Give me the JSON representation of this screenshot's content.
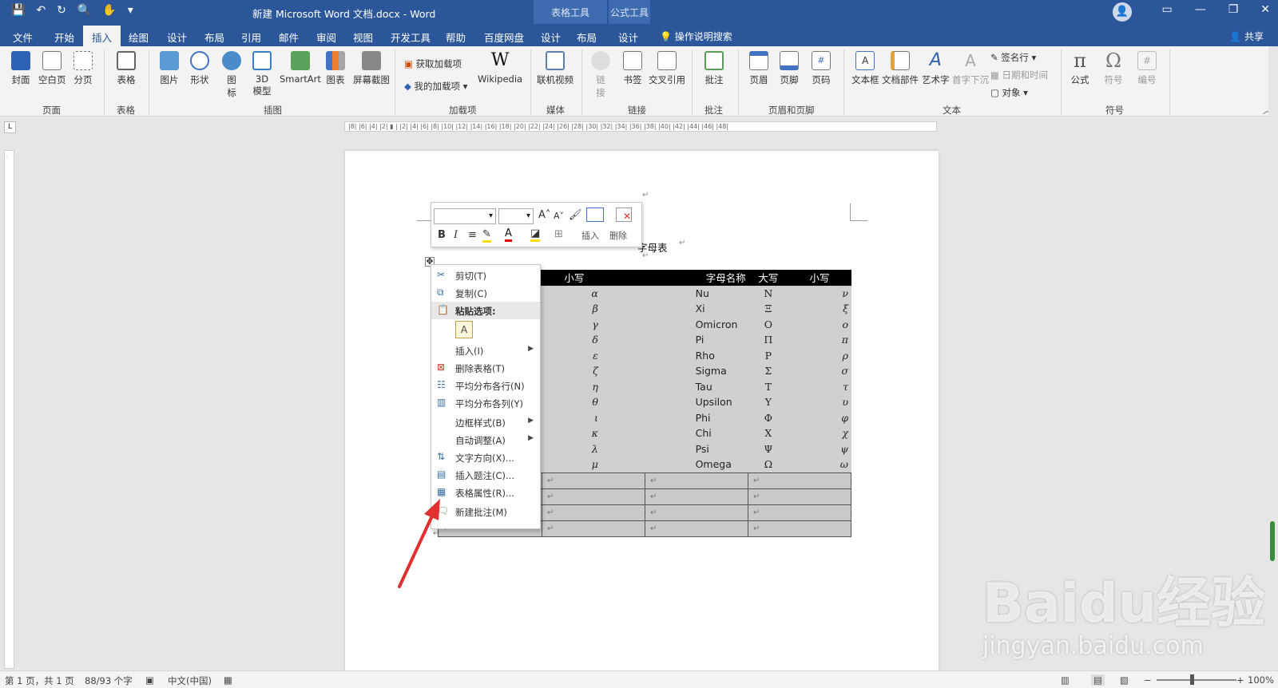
{
  "titlebar": {
    "title": "新建 Microsoft Word 文档.docx  -  Word",
    "ctx_table": "表格工具",
    "ctx_formula": "公式工具"
  },
  "tabs": {
    "file": "文件",
    "home": "开始",
    "insert": "插入",
    "draw": "绘图",
    "design": "设计",
    "layout": "布局",
    "references": "引用",
    "mailings": "邮件",
    "review": "审阅",
    "view": "视图",
    "developer": "开发工具",
    "help": "帮助",
    "baidu": "百度网盘",
    "t_design": "设计",
    "t_layout": "布局",
    "f_design": "设计",
    "tell": "操作说明搜索",
    "share": "共享"
  },
  "ribbon": {
    "cover": "封面",
    "blank": "空白页",
    "break": "分页",
    "g_pages": "页面",
    "table": "表格",
    "g_table": "表格",
    "picture": "图片",
    "shapes": "形状",
    "icons1": "图",
    "icons2": "标",
    "model1": "3D",
    "model2": "模型",
    "smartart": "SmartArt",
    "chart": "图表",
    "screenshot": "屏幕截图",
    "g_illus": "插图",
    "get_addins": "获取加载项",
    "my_addins": "我的加载项",
    "wikipedia": "Wikipedia",
    "g_addins": "加载项",
    "video": "联机视频",
    "g_media": "媒体",
    "link1": "链",
    "link2": "接",
    "bookmark": "书签",
    "crossref": "交叉引用",
    "g_links": "链接",
    "comment": "批注",
    "g_comments": "批注",
    "header": "页眉",
    "footer": "页脚",
    "pagenum": "页码",
    "g_hf": "页眉和页脚",
    "textbox": "文本框",
    "quickparts": "文档部件",
    "wordart": "艺术字",
    "dropcap": "首字下沉",
    "sigline": "签名行",
    "datetime": "日期和时间",
    "object": "对象",
    "g_text": "文本",
    "equation": "公式",
    "symbol": "符号",
    "number": "编号",
    "g_symbols": "符号"
  },
  "document": {
    "title_visible": "字母表"
  },
  "minitoolbar": {
    "insert": "插入",
    "delete": "删除"
  },
  "table": {
    "headers": [
      "小写",
      "",
      "字母名称",
      "大写",
      "小写"
    ],
    "rows": [
      [
        "α",
        "Nu",
        "Ν",
        "ν"
      ],
      [
        "β",
        "Xi",
        "Ξ",
        "ξ"
      ],
      [
        "γ",
        "Omicron",
        "Ο",
        "ο"
      ],
      [
        "δ",
        "Pi",
        "Π",
        "π"
      ],
      [
        "ε",
        "Rho",
        "Ρ",
        "ρ"
      ],
      [
        "ζ",
        "Sigma",
        "Σ",
        "σ"
      ],
      [
        "η",
        "Tau",
        "Τ",
        "τ"
      ],
      [
        "θ",
        "Upsilon",
        "Υ",
        "υ"
      ],
      [
        "ι",
        "Phi",
        "Φ",
        "φ"
      ],
      [
        "κ",
        "Chi",
        "Χ",
        "χ"
      ],
      [
        "λ",
        "Psi",
        "Ψ",
        "ψ"
      ],
      [
        "μ",
        "Omega",
        "Ω",
        "ω"
      ]
    ]
  },
  "context_menu": {
    "cut": "剪切(T)",
    "copy": "复制(C)",
    "paste_options": "粘贴选项:",
    "insert": "插入(I)",
    "delete_table": "删除表格(T)",
    "dist_rows": "平均分布各行(N)",
    "dist_cols": "平均分布各列(Y)",
    "border_styles": "边框样式(B)",
    "autofit": "自动调整(A)",
    "text_direction": "文字方向(X)...",
    "insert_caption": "插入题注(C)...",
    "table_props": "表格属性(R)...",
    "new_comment": "新建批注(M)"
  },
  "statusbar": {
    "page": "第 1 页，共 1 页",
    "words": "88/93 个字",
    "lang": "中文(中国)",
    "zoom": "100%"
  },
  "watermark": {
    "brand": "Baidu经验",
    "url": "jingyan.baidu.com"
  },
  "colors": {
    "accent": "#2b579a",
    "arrow": "#e03030"
  }
}
